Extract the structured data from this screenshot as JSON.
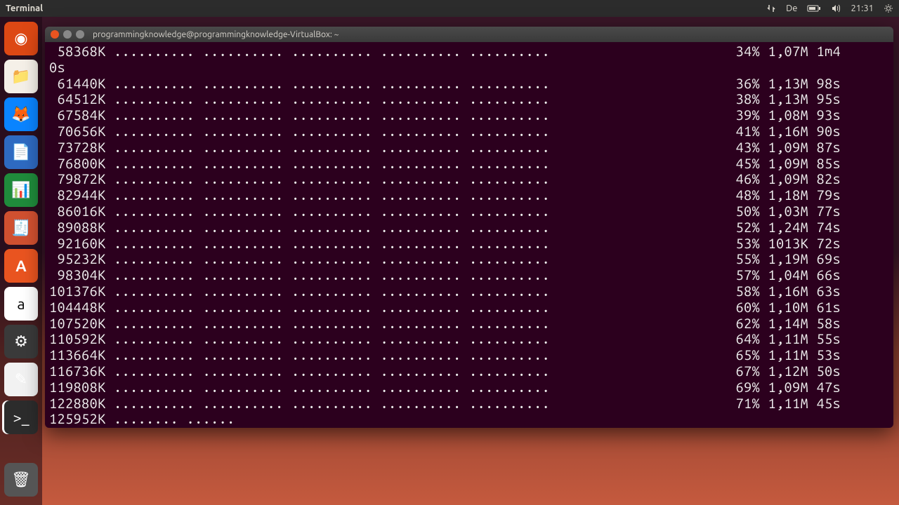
{
  "topbar": {
    "app_title": "Terminal",
    "keyboard_layout": "De",
    "clock": "21:31"
  },
  "launcher": {
    "items": [
      {
        "name": "ubuntu-dash",
        "bg": "#dd4814",
        "glyph": "◉"
      },
      {
        "name": "files",
        "bg": "#f5f0e8",
        "glyph": "📁"
      },
      {
        "name": "firefox",
        "bg": "#0a84ff",
        "glyph": "🦊"
      },
      {
        "name": "writer",
        "bg": "#2e6ac1",
        "glyph": "📄"
      },
      {
        "name": "calc",
        "bg": "#1f8b3b",
        "glyph": "📊"
      },
      {
        "name": "impress",
        "bg": "#d05030",
        "glyph": "🧾"
      },
      {
        "name": "software-center",
        "bg": "#e95420",
        "glyph": "A"
      },
      {
        "name": "amazon",
        "bg": "#ffffff",
        "glyph": "a"
      },
      {
        "name": "settings",
        "bg": "#3a3a3a",
        "glyph": "⚙"
      },
      {
        "name": "text-editor",
        "bg": "#f2f2f2",
        "glyph": "✎"
      },
      {
        "name": "terminal",
        "bg": "#2c2c2c",
        "glyph": ">_"
      }
    ],
    "trash_glyph": "🗑"
  },
  "terminal": {
    "title": "programmingknowledge@programmingknowledge-VirtualBox: ~",
    "dots_full": ".......... .......... .......... .......... ..........",
    "dots_partial": "........ ......",
    "wrap_tail": "0s",
    "rows": [
      {
        "size": " 58368K",
        "pct": "34%",
        "rate": "1,07M",
        "eta": "1m4"
      },
      {
        "size": " 61440K",
        "pct": "36%",
        "rate": "1,13M",
        "eta": "98s"
      },
      {
        "size": " 64512K",
        "pct": "38%",
        "rate": "1,13M",
        "eta": "95s"
      },
      {
        "size": " 67584K",
        "pct": "39%",
        "rate": "1,08M",
        "eta": "93s"
      },
      {
        "size": " 70656K",
        "pct": "41%",
        "rate": "1,16M",
        "eta": "90s"
      },
      {
        "size": " 73728K",
        "pct": "43%",
        "rate": "1,09M",
        "eta": "87s"
      },
      {
        "size": " 76800K",
        "pct": "45%",
        "rate": "1,09M",
        "eta": "85s"
      },
      {
        "size": " 79872K",
        "pct": "46%",
        "rate": "1,09M",
        "eta": "82s"
      },
      {
        "size": " 82944K",
        "pct": "48%",
        "rate": "1,18M",
        "eta": "79s"
      },
      {
        "size": " 86016K",
        "pct": "50%",
        "rate": "1,03M",
        "eta": "77s"
      },
      {
        "size": " 89088K",
        "pct": "52%",
        "rate": "1,24M",
        "eta": "74s"
      },
      {
        "size": " 92160K",
        "pct": "53%",
        "rate": "1013K",
        "eta": "72s"
      },
      {
        "size": " 95232K",
        "pct": "55%",
        "rate": "1,19M",
        "eta": "69s"
      },
      {
        "size": " 98304K",
        "pct": "57%",
        "rate": "1,04M",
        "eta": "66s"
      },
      {
        "size": "101376K",
        "pct": "58%",
        "rate": "1,16M",
        "eta": "63s"
      },
      {
        "size": "104448K",
        "pct": "60%",
        "rate": "1,10M",
        "eta": "61s"
      },
      {
        "size": "107520K",
        "pct": "62%",
        "rate": "1,14M",
        "eta": "58s"
      },
      {
        "size": "110592K",
        "pct": "64%",
        "rate": "1,11M",
        "eta": "55s"
      },
      {
        "size": "113664K",
        "pct": "65%",
        "rate": "1,11M",
        "eta": "53s"
      },
      {
        "size": "116736K",
        "pct": "67%",
        "rate": "1,12M",
        "eta": "50s"
      },
      {
        "size": "119808K",
        "pct": "69%",
        "rate": "1,09M",
        "eta": "47s"
      },
      {
        "size": "122880K",
        "pct": "71%",
        "rate": "1,11M",
        "eta": "45s"
      }
    ],
    "last_partial_size": "125952K"
  }
}
